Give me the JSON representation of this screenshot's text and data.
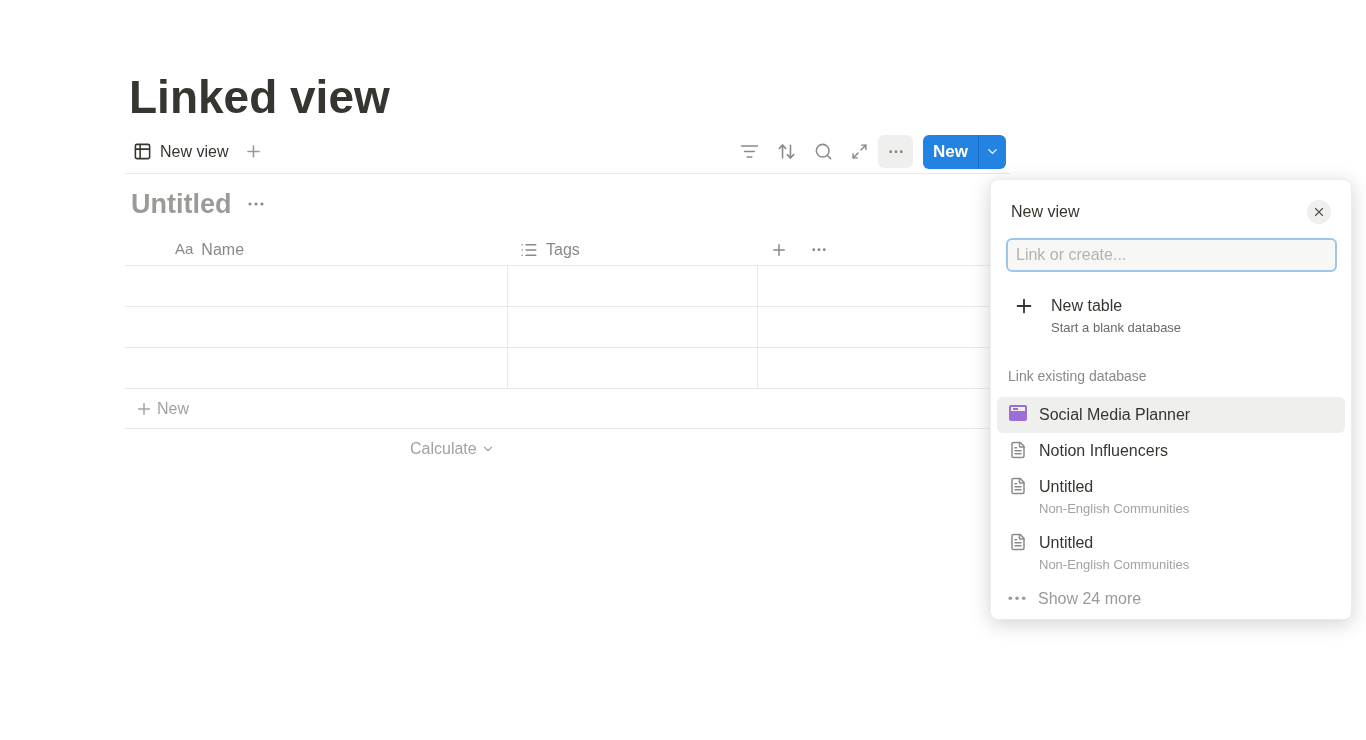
{
  "page_title": "Linked view",
  "view_tab": {
    "label": "New view"
  },
  "new_button": {
    "label": "New"
  },
  "database": {
    "title": "Untitled",
    "columns": [
      {
        "kind": "text",
        "icon_text": "Aa",
        "label": "Name"
      },
      {
        "kind": "list",
        "label": "Tags"
      }
    ],
    "add_row": "New",
    "calculate": "Calculate"
  },
  "popup": {
    "title": "New view",
    "search_placeholder": "Link or create...",
    "new_table": {
      "title": "New table",
      "subtitle": "Start a blank database"
    },
    "section": "Link existing database",
    "items": [
      {
        "kind": "database",
        "title": "Social Media Planner",
        "selected": true
      },
      {
        "kind": "page",
        "title": "Notion Influencers",
        "selected": false
      },
      {
        "kind": "page",
        "title": "Untitled",
        "subtitle": "Non-English Communities",
        "selected": false
      },
      {
        "kind": "page",
        "title": "Untitled",
        "subtitle": "Non-English Communities",
        "selected": false
      }
    ],
    "show_more": "Show 24 more"
  }
}
